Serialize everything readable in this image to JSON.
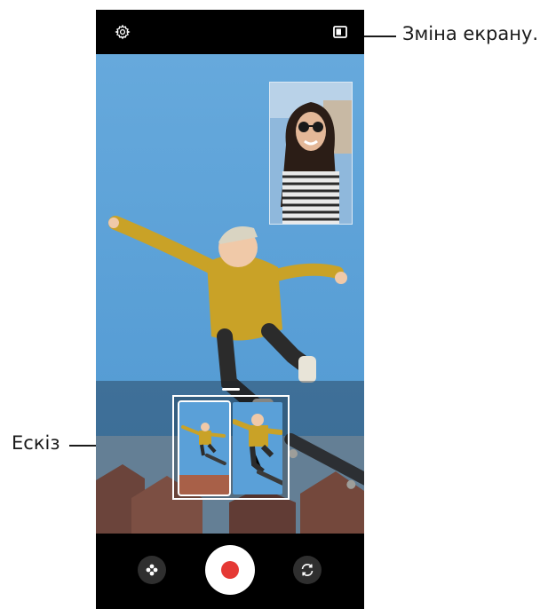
{
  "callouts": {
    "screen_change": "Зміна екрану.",
    "thumbnail": "Ескіз"
  },
  "camera": {
    "top_bar": {
      "settings_icon": "gear-icon",
      "screen_change_icon": "screen-switch-icon"
    },
    "bottom_bar": {
      "effects_icon": "flower-icon",
      "shutter": "record-button",
      "flip_icon": "camera-flip-icon"
    }
  },
  "colors": {
    "record": "#e53935",
    "bar": "#000000",
    "sky": "#5aa0d8",
    "jacket": "#c9a227"
  }
}
